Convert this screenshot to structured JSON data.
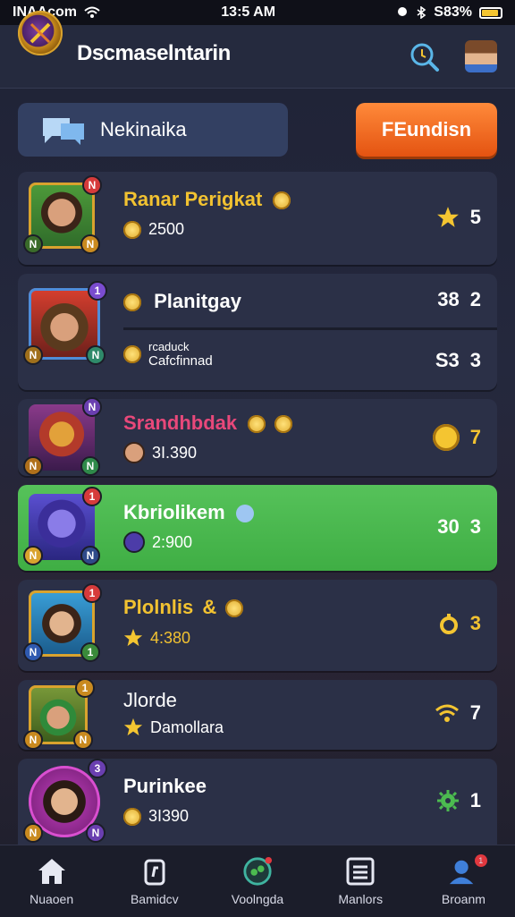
{
  "status": {
    "carrier": "INAAcom",
    "time": "13:5 AM",
    "battery": "S83%",
    "battery_fraction": 0.83
  },
  "header": {
    "title": "Dscmaselntarin",
    "logo_icon": "shield-emblem",
    "search_icon": "search-icon",
    "avatar": "user-avatar"
  },
  "tabs": {
    "left_label": "Nekinaika",
    "right_label": "FEundisn",
    "left_icon": "chat-bubble-icon"
  },
  "accent": {
    "orange": "#f06a1f",
    "green": "#4cbb50",
    "gold": "#f2c231"
  },
  "rows": [
    {
      "name": "Ranar Perigkat",
      "name_color": "#f2c231",
      "sub": "2500",
      "sub2": "",
      "value": "5",
      "value_prefix": "",
      "right_icon": "star-icon",
      "badges": [
        "N",
        "N",
        "N"
      ]
    },
    {
      "name": "Planitgay",
      "name_color": "#ffffff",
      "sub": "Cafcfinnad",
      "sub2": "rcaduck",
      "value": "2",
      "value_prefix": "38",
      "value2": "3",
      "value2_prefix": "S3",
      "right_icon": "",
      "badges": [
        "1",
        "N",
        "N"
      ]
    },
    {
      "name": "Srandhbdak",
      "name_color": "#e8487a",
      "sub": "3I.390",
      "sub2": "",
      "value": "7",
      "value_prefix": "",
      "right_icon": "medal-icon",
      "badges": [
        "N",
        "N",
        "N"
      ]
    },
    {
      "name": "Kbriolikem",
      "name_color": "#ffffff",
      "sub": "2:900",
      "sub2": "",
      "value": "3",
      "value_prefix": "30",
      "right_icon": "",
      "badges": [
        "1",
        "N",
        "N"
      ]
    },
    {
      "name": "Plolnlis",
      "name_color": "#f2c231",
      "sub": "4:380",
      "sub2": "",
      "value": "3",
      "value_prefix": "",
      "right_icon": "trophy-icon",
      "badges": [
        "1",
        "1",
        "N"
      ]
    },
    {
      "name": "Jlorde",
      "name_color": "#ffffff",
      "sub": "Damollara",
      "sub2": "",
      "value": "7",
      "value_prefix": "",
      "right_icon": "wifi-icon",
      "badges": [
        "1",
        "N",
        "N"
      ]
    },
    {
      "name": "Purinkee",
      "name_color": "#ffffff",
      "sub": "3I390",
      "sub2": "",
      "value": "1",
      "value_prefix": "",
      "right_icon": "gear-icon",
      "badges": [
        "3",
        "N",
        "N"
      ]
    }
  ],
  "nav": [
    {
      "label": "Nuaoen",
      "icon": "home-icon"
    },
    {
      "label": "Bamidcv",
      "icon": "controller-icon"
    },
    {
      "label": "Voolngda",
      "icon": "play-icon"
    },
    {
      "label": "Manlors",
      "icon": "list-icon"
    },
    {
      "label": "Broanm",
      "icon": "profile-icon",
      "badge": "1"
    }
  ]
}
